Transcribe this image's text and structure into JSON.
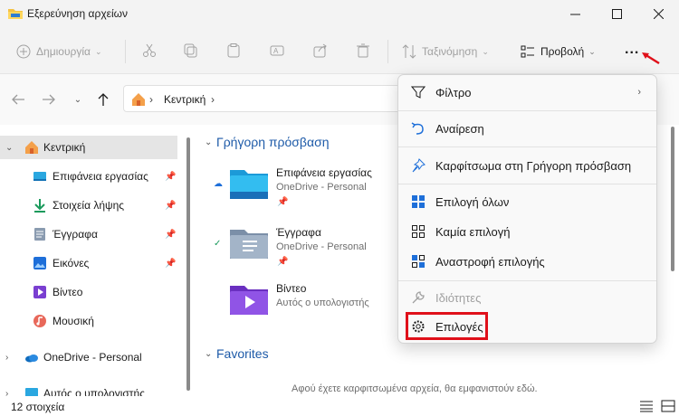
{
  "window": {
    "title": "Εξερεύνηση αρχείων"
  },
  "toolbar": {
    "new_label": "Δημιουργία",
    "sort_label": "Ταξινόμηση",
    "view_label": "Προβολή",
    "more_label": "..."
  },
  "address": {
    "segment": "Κεντρική"
  },
  "sidebar": {
    "items": [
      {
        "label": "Κεντρική",
        "icon": "home-icon"
      },
      {
        "label": "Επιφάνεια εργασίας",
        "icon": "desktop-icon"
      },
      {
        "label": "Στοιχεία λήψης",
        "icon": "download-icon"
      },
      {
        "label": "Έγγραφα",
        "icon": "documents-icon"
      },
      {
        "label": "Εικόνες",
        "icon": "pictures-icon"
      },
      {
        "label": "Βίντεο",
        "icon": "videos-icon"
      },
      {
        "label": "Μουσική",
        "icon": "music-icon"
      },
      {
        "label": "OneDrive - Personal",
        "icon": "onedrive-icon"
      },
      {
        "label": "Αυτός ο υπολογιστής",
        "icon": "pc-icon"
      }
    ]
  },
  "main": {
    "quick_access_title": "Γρήγορη πρόσβαση",
    "favorites_title": "Favorites",
    "items": [
      {
        "name": "Επιφάνεια εργασίας",
        "sub": "OneDrive - Personal"
      },
      {
        "name": "Έγγραφα",
        "sub": "OneDrive - Personal"
      },
      {
        "name": "Βίντεο",
        "sub": "Αυτός ο υπολογιστής"
      }
    ],
    "favorites_empty": "Αφού έχετε καρφιτσωμένα αρχεία, θα εμφανιστούν εδώ."
  },
  "status": {
    "count": "12 στοιχεία"
  },
  "menu": {
    "items": [
      {
        "label": "Φίλτρο",
        "icon": "filter-icon"
      },
      {
        "label": "Αναίρεση",
        "icon": "undo-icon"
      },
      {
        "label": "Καρφίτσωμα στη Γρήγορη πρόσβαση",
        "icon": "pin-icon"
      },
      {
        "label": "Επιλογή όλων",
        "icon": "select-all-icon"
      },
      {
        "label": "Καμία επιλογή",
        "icon": "select-none-icon"
      },
      {
        "label": "Αναστροφή επιλογής",
        "icon": "invert-selection-icon"
      },
      {
        "label": "Ιδιότητες",
        "icon": "properties-icon"
      },
      {
        "label": "Επιλογές",
        "icon": "gear-icon"
      }
    ]
  },
  "colors": {
    "accent": "#1d5aa8",
    "highlight": "#e0101a"
  }
}
